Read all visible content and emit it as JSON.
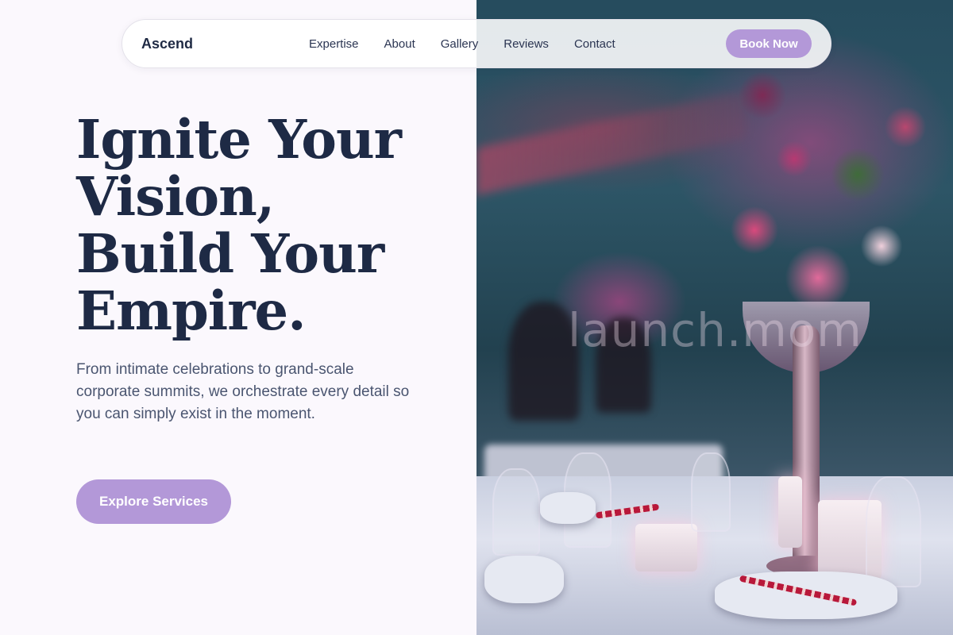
{
  "nav": {
    "brand": "Ascend",
    "links": [
      {
        "label": "Expertise"
      },
      {
        "label": "About"
      },
      {
        "label": "Gallery"
      },
      {
        "label": "Reviews"
      },
      {
        "label": "Contact"
      }
    ],
    "cta_label": "Book Now"
  },
  "hero": {
    "title_lines": [
      "Ignite Your",
      "Vision,",
      "Build Your",
      "Empire."
    ],
    "subtitle": "From intimate celebrations to grand-scale corporate summits, we orchestrate every detail so you can simply exist in the moment.",
    "cta_label": "Explore Services"
  },
  "hero_image": {
    "watermark": "launch.mom"
  },
  "colors": {
    "accent": "#b398d8",
    "heading": "#1e2a45",
    "body_text": "#4a5570",
    "background": "#fbf8fd"
  }
}
